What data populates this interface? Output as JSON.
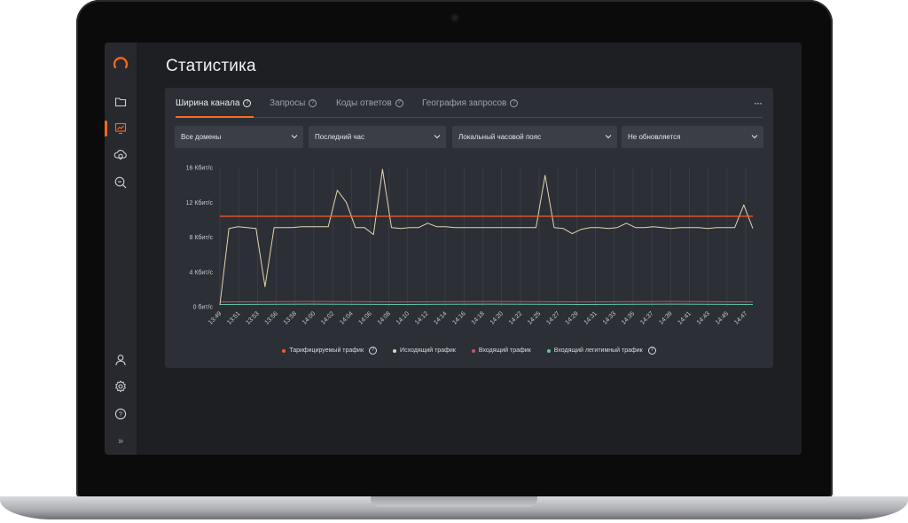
{
  "page": {
    "title": "Статистика"
  },
  "sidebar": {
    "items": [
      {
        "icon": "folder-icon"
      },
      {
        "icon": "chart-icon",
        "active": true
      },
      {
        "icon": "cloud-shield-icon"
      },
      {
        "icon": "search-zoom-icon"
      },
      {
        "icon": "user-icon"
      },
      {
        "icon": "gear-icon"
      },
      {
        "icon": "help-icon",
        "label": "?"
      },
      {
        "icon": "expand-icon",
        "label": "»"
      }
    ]
  },
  "tabs": [
    {
      "label": "Ширина канала",
      "active": true
    },
    {
      "label": "Запросы"
    },
    {
      "label": "Коды ответов"
    },
    {
      "label": "География запросов"
    }
  ],
  "more_label": "···",
  "filters": {
    "domain": "Все домены",
    "period": "Последний час",
    "timezone": "Локальный часовой пояс",
    "refresh": "Не обновляется"
  },
  "colors": {
    "accent": "#ff6a1a",
    "billed": "#ff5a1f",
    "outgoing": "#e6d3b0",
    "incoming": "#c0566b",
    "legit": "#5fc6a8"
  },
  "chart_data": {
    "type": "line",
    "y_ticks": [
      "0 бит/с",
      "4 Кбит/с",
      "8 Кбит/с",
      "12 Кбит/с",
      "16 Кбит/с"
    ],
    "ylim": [
      0,
      16
    ],
    "y_unit": "Кбит/с",
    "grid": true,
    "x_ticks": [
      "13:49",
      "13:51",
      "13:53",
      "13:56",
      "13:58",
      "14:00",
      "14:02",
      "14:04",
      "14:06",
      "14:08",
      "14:10",
      "14:12",
      "14:14",
      "14:16",
      "14:18",
      "14:20",
      "14:22",
      "14:25",
      "14:27",
      "14:29",
      "14:31",
      "14:33",
      "14:35",
      "14:37",
      "14:39",
      "14:41",
      "14:43",
      "14:45",
      "14:47"
    ],
    "x_range": [
      0,
      59
    ],
    "series": [
      {
        "name": "Тарифицируемый трафик",
        "has_help": true,
        "color": "#ff5a1f",
        "x": [
          0,
          59
        ],
        "values": [
          10.4,
          10.4
        ]
      },
      {
        "name": "Исходящий трафик",
        "color": "#e6d3b0",
        "x": [
          0,
          1,
          2,
          3,
          4,
          5,
          6,
          7,
          8,
          9,
          10,
          11,
          12,
          13,
          14,
          15,
          16,
          17,
          18,
          19,
          20,
          21,
          22,
          23,
          24,
          25,
          26,
          27,
          28,
          29,
          30,
          31,
          32,
          33,
          34,
          35,
          36,
          37,
          38,
          39,
          40,
          41,
          42,
          43,
          44,
          45,
          46,
          47,
          48,
          49,
          50,
          51,
          52,
          53,
          54,
          55,
          56,
          57,
          58,
          59
        ],
        "values": [
          0.2,
          9.0,
          9.2,
          9.1,
          9.0,
          2.3,
          9.1,
          9.1,
          9.1,
          9.2,
          9.2,
          9.2,
          9.2,
          13.4,
          12.0,
          9.1,
          9.1,
          8.3,
          15.8,
          9.1,
          9.0,
          9.1,
          9.1,
          9.6,
          9.2,
          9.2,
          9.1,
          9.1,
          9.1,
          9.1,
          9.1,
          9.1,
          9.1,
          9.1,
          9.1,
          9.1,
          15.1,
          9.1,
          9.0,
          8.4,
          8.9,
          9.1,
          9.1,
          9.0,
          9.1,
          9.6,
          9.1,
          9.1,
          9.2,
          9.1,
          9.0,
          9.1,
          9.1,
          9.1,
          9.0,
          9.1,
          9.1,
          9.1,
          11.7,
          9.0
        ]
      },
      {
        "name": "Входящий трафик",
        "color": "#c0566b",
        "x": [
          0,
          10,
          20,
          30,
          40,
          50,
          59
        ],
        "values": [
          0.55,
          0.6,
          0.55,
          0.6,
          0.55,
          0.6,
          0.55
        ]
      },
      {
        "name": "Входящий легитимный трафик",
        "has_help": true,
        "color": "#5fc6a8",
        "x": [
          0,
          10,
          20,
          30,
          40,
          50,
          59
        ],
        "values": [
          0.25,
          0.3,
          0.25,
          0.3,
          0.25,
          0.3,
          0.25
        ]
      }
    ]
  }
}
